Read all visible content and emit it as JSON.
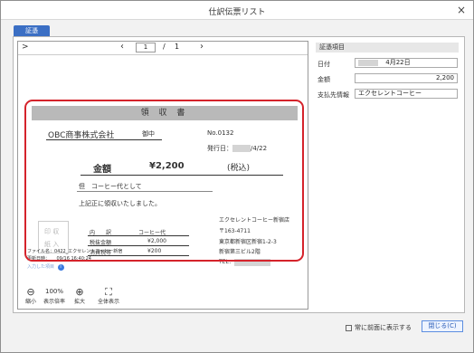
{
  "window": {
    "title": "仕訳伝票リスト",
    "close_icon": "×"
  },
  "tab": {
    "label": "証憑"
  },
  "viewer": {
    "expand_icon": ">",
    "prev_icon": "‹",
    "page_current": "1",
    "page_sep": "/",
    "page_total": "1",
    "next_icon": "›"
  },
  "receipt": {
    "title": "領 収 書",
    "recipient": "OBC商事株式会社",
    "honorific": "御中",
    "number": "No.0132",
    "issue_date_label": "発行日：",
    "issue_date_suffix": "/4/22",
    "amount_label": "金額",
    "amount": "¥2,200",
    "tax_note": "(税込)",
    "tadashi": "但　コーヒー代として",
    "received": "上記正に領収いたしました。",
    "stamp_line1": "印 収",
    "stamp_line2": "紙 入",
    "detail_label1": "内　　訳",
    "detail_value1": "コーヒー代",
    "detail_label2": "税抜金額",
    "detail_value2": "¥2,000",
    "detail_label3": "消費税等",
    "detail_value3": "¥200",
    "issuer_name": "エクセレントコーヒー新宿店",
    "issuer_zip": "〒163-4711",
    "issuer_addr1": "東京都新宿区新宿1-2-3",
    "issuer_addr2": "新宿第三ビル2階",
    "issuer_tel": "TEL：",
    "file_name": "ファイル名：0422_エクセレントコーヒー新宿",
    "update_date": "更新日時：　　09/16 16:40:24",
    "info_label": "入力した項目"
  },
  "bottom_tools": {
    "zoom_out_label": "縮小",
    "zoom_value": "100%",
    "zoom_rate_label": "表示倍率",
    "zoom_in_label": "拡大",
    "fit_label": "全体表示"
  },
  "fields": {
    "section_title": "証憑項目",
    "date_label": "日付",
    "date_value": "4月22日",
    "amount_label": "金額",
    "amount_value": "2,200",
    "payee_label": "支払先情報",
    "payee_value": "エクセレントコーヒー"
  },
  "footer": {
    "always_front_label": "常に前面に表示する",
    "close_label": "閉じる(C)"
  }
}
